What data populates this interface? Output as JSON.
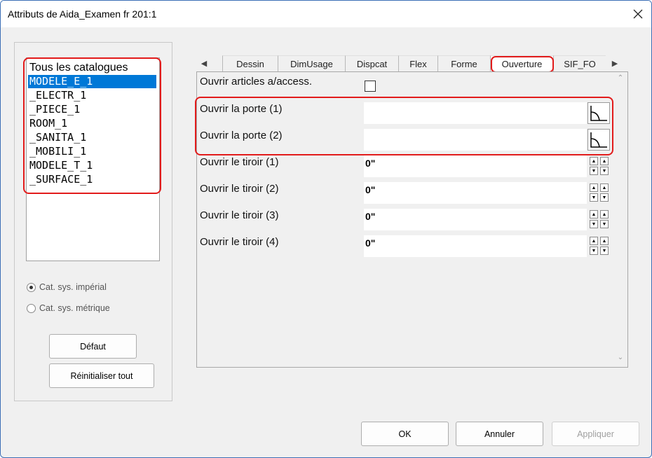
{
  "window": {
    "title": "Attributs de Aida_Examen fr 201:1",
    "close_icon": "close-icon"
  },
  "catalog_list": {
    "header": "Tous les catalogues",
    "items": [
      "MODELE_E_1",
      "_ELECTR_1",
      "_PIECE_1",
      "ROOM_1",
      "_SANITA_1",
      "_MOBILI_1",
      "MODELE_T_1",
      "_SURFACE_1"
    ],
    "selected": "MODELE_E_1"
  },
  "catalog_system": {
    "imperial_label": "Cat. sys. impérial",
    "metric_label": "Cat. sys. métrique",
    "selected": "imperial"
  },
  "left_buttons": {
    "default_label": "Défaut",
    "reset_label": "Réinitialiser tout"
  },
  "tabs": [
    "Dessin",
    "DimUsage",
    "Dispcat",
    "Flex",
    "Forme",
    "Ouverture",
    "SIF_FO"
  ],
  "active_tab": "Ouverture",
  "attributes": [
    {
      "label": "Ouvrir articles a/access.",
      "type": "checkbox",
      "checked": false
    },
    {
      "label": "Ouvrir la porte (1)",
      "type": "angle",
      "value": ""
    },
    {
      "label": "Ouvrir la porte (2)",
      "type": "angle",
      "value": ""
    },
    {
      "label": "Ouvrir le tiroir (1)",
      "type": "spinner",
      "value": "0\""
    },
    {
      "label": "Ouvrir le tiroir (2)",
      "type": "spinner",
      "value": "0\""
    },
    {
      "label": "Ouvrir le tiroir (3)",
      "type": "spinner",
      "value": "0\""
    },
    {
      "label": "Ouvrir le tiroir (4)",
      "type": "spinner",
      "value": "0\""
    }
  ],
  "footer": {
    "ok_label": "OK",
    "cancel_label": "Annuler",
    "apply_label": "Appliquer",
    "apply_enabled": false
  },
  "colors": {
    "selection": "#0078d7",
    "highlight": "#e21b1b",
    "window_border": "#3c6fb6"
  }
}
